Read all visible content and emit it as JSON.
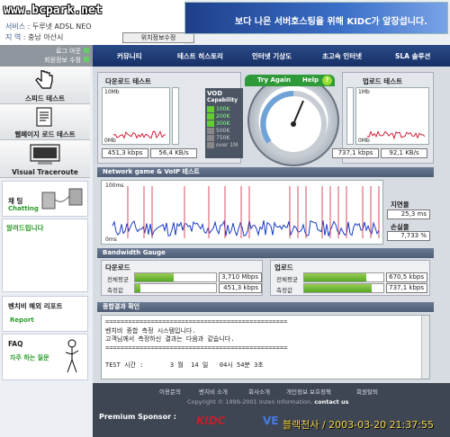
{
  "watermark": "www.bcpark.net",
  "service": {
    "label": "서비스 :",
    "value": "두루넷 ADSL NEO",
    "region_label": "지  역 :",
    "region_value": "충남 아산시",
    "edit_button": "위치정보수정"
  },
  "banner": {
    "text": "보다 나은 서버호스팅을 위해 KIDC가 앞장섭니다."
  },
  "login": {
    "logout": "로그 아웃",
    "member_edit": "회원정보 수정"
  },
  "nav": [
    "커뮤니티",
    "테스트 히스토리",
    "인터넷 기상도",
    "초고속 인터넷",
    "SLA 솔루션"
  ],
  "left_menu": {
    "speed_test": "스피드 테스트",
    "page_load": "웹페이지 로드 테스트",
    "traceroute": "Visual Traceroute",
    "chat_title": "채 팅",
    "chat_sub": "Chatting",
    "notice": "알려드립니다",
    "report_title": "벤치비 해외 리포트",
    "report_sub": "Report",
    "faq_title": "FAQ",
    "faq_sub": "자주 하는 질문"
  },
  "download": {
    "title": "다운로드 테스트",
    "top": "10Mb",
    "bottom": "0Mb",
    "kbps": "451,3 kbps",
    "kbs": "56,4 KB/s"
  },
  "upload": {
    "title": "업로드 테스트",
    "top": "1Mb",
    "bottom": "0Mb",
    "kbps": "737,1 kbps",
    "kbs": "92,1 KB/s"
  },
  "vod": {
    "title": "VOD",
    "subtitle": "Capability",
    "levels": [
      "100K",
      "300K",
      "500K",
      "750K",
      "over 1M"
    ],
    "levels_full": [
      "100K",
      "200K",
      "300K",
      "500K",
      "750K",
      "over 1M"
    ]
  },
  "gauge": {
    "try": "Try Again",
    "help": "Help",
    "help_icon": "?"
  },
  "network": {
    "title": "Network game & VoIP 테스트",
    "top": "100ms",
    "bottom": "0ms",
    "latency_label": "지연율",
    "latency": "25,3 ms",
    "loss_label": "손실율",
    "loss": "7,733 %"
  },
  "bandwidth": {
    "title": "Bandwidth Gauge",
    "download": "다운로드",
    "upload": "업로드",
    "avg_label": "전체평균",
    "measure_label": "측정값",
    "dl_avg": "3,710 Mbps",
    "dl_meas": "451,3 kbps",
    "ul_avg": "670,5 kbps",
    "ul_meas": "737,1 kbps",
    "dl_avg_frac": 0.48,
    "dl_meas_frac": 0.07,
    "ul_avg_frac": 0.78,
    "ul_meas_frac": 0.85
  },
  "result": {
    "title": "종합결과 확인",
    "lines": [
      "================================================",
      "벤치비 종합 측정 시스템입니다.",
      "고객님께서 측정하신 결과는 다음과 같습니다.",
      "================================================",
      "",
      "TEST 시간 :       3 월  14 일   04시 54분 3초"
    ]
  },
  "footer": {
    "links": [
      "이용문의",
      "벤치비 소개",
      "회사소개",
      "개인정보 보호정책",
      "회원탈퇴"
    ],
    "copyright": "Copyright © 1999-2001 Inzen Information.",
    "contact": "contact us",
    "sponsor": "Premium Sponsor :",
    "kidc": "KIDC",
    "ve": "VE",
    "stamp": "블랙천사 / 2003-03-20 21:37:55"
  },
  "colors": {
    "nav": "#1e3b78",
    "download_line": "#d0203a",
    "upload_line": "#1a3cc8",
    "bar": "#7ab83a"
  }
}
